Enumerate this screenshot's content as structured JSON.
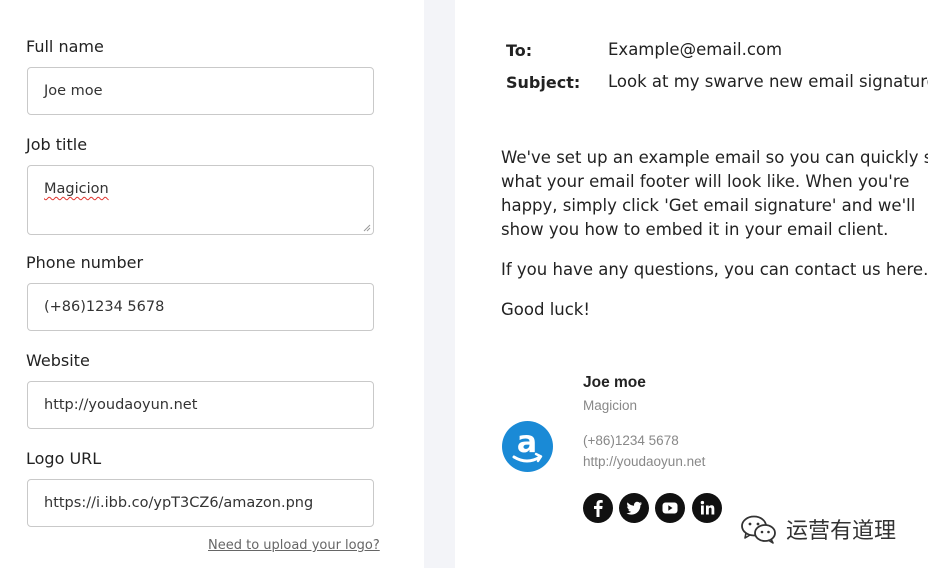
{
  "form": {
    "full_name": {
      "label": "Full name",
      "value": "Joe moe"
    },
    "job_title": {
      "label": "Job title",
      "value": "Magicion"
    },
    "phone": {
      "label": "Phone number",
      "value": "(+86)1234 5678"
    },
    "website": {
      "label": "Website",
      "value": "http://youdaoyun.net"
    },
    "logo_url": {
      "label": "Logo URL",
      "value": "https://i.ibb.co/ypT3CZ6/amazon.png"
    },
    "upload_link": "Need to upload your logo?"
  },
  "email": {
    "to_label": "To:",
    "to_value": "Example@email.com",
    "subject_label": "Subject:",
    "subject_value": "Look at my swarve new email signature!",
    "paragraph1": "We've set up an example email so you can quickly see what your email footer will look like. When you're happy, simply click 'Get email signature' and we'll show you how to embed it in your email client.",
    "paragraph2": "If you have any questions, you can contact us here.",
    "paragraph3": "Good luck!"
  },
  "signature": {
    "name": "Joe moe",
    "title": "Magicion",
    "phone": "(+86)1234 5678",
    "website": "http://youdaoyun.net",
    "logo_icon": "amazon-logo-icon",
    "social_icons": [
      "facebook-icon",
      "twitter-icon",
      "youtube-icon",
      "linkedin-icon"
    ]
  },
  "watermark": {
    "text": "运营有道理",
    "icon": "wechat-icon"
  },
  "colors": {
    "logo_blue": "#1a8ad6",
    "divider": "#f3f4f8",
    "border": "#c9c9c9"
  }
}
